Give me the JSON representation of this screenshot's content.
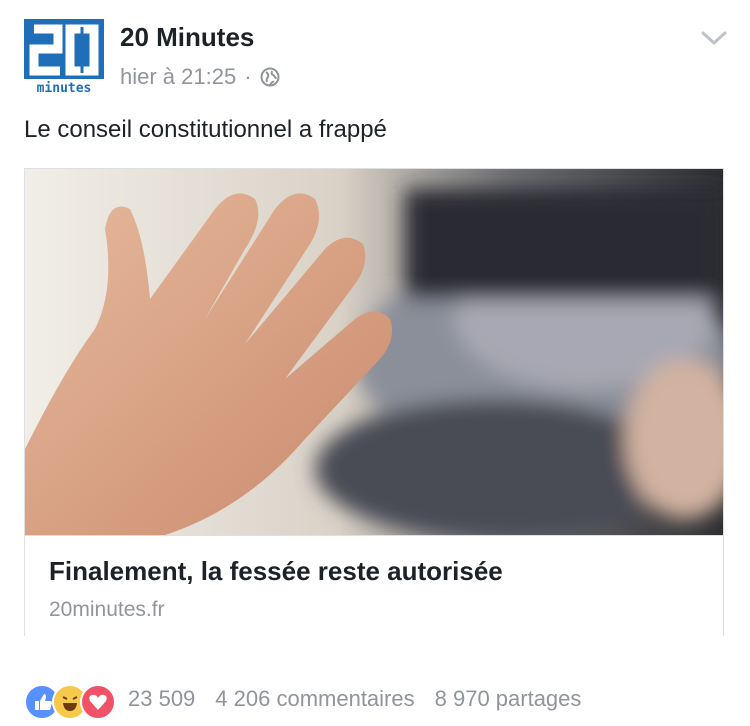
{
  "post": {
    "page_name": "20 Minutes",
    "avatar": {
      "number": "20",
      "brand_text": "minutes",
      "brand_color": "#1f6fb8"
    },
    "timestamp": "hier à 21:25",
    "separator": "·",
    "caption": "Le conseil constitutionnel a frappé",
    "link_card": {
      "title": "Finalement, la fessée reste autorisée",
      "domain": "20minutes.fr"
    },
    "reactions": {
      "icons": [
        "like-icon",
        "haha-icon",
        "love-icon"
      ],
      "count": "23 509",
      "comments": "4 206 commentaires",
      "shares": "8 970 partages"
    }
  }
}
